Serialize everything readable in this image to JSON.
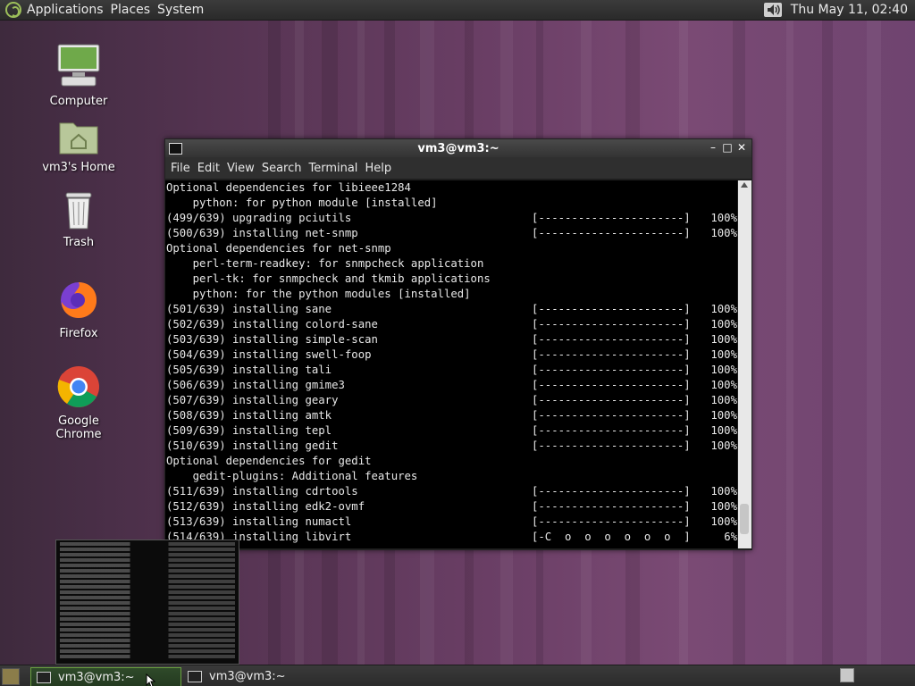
{
  "top_panel": {
    "menus": [
      "Applications",
      "Places",
      "System"
    ],
    "clock": "Thu May 11, 02:40"
  },
  "desktop_icons": [
    {
      "name": "computer",
      "label": "Computer"
    },
    {
      "name": "home",
      "label": "vm3's Home"
    },
    {
      "name": "trash",
      "label": "Trash"
    },
    {
      "name": "firefox",
      "label": "Firefox"
    },
    {
      "name": "chrome",
      "label": "Google Chrome"
    }
  ],
  "terminal": {
    "title": "vm3@vm3:~",
    "menus": [
      "File",
      "Edit",
      "View",
      "Search",
      "Terminal",
      "Help"
    ],
    "lines": [
      {
        "text": "Optional dependencies for libieee1284"
      },
      {
        "text": "    python: for python module [installed]"
      },
      {
        "text": "(499/639) upgrading pciutils",
        "bar": "[----------------------]",
        "pct": "100%"
      },
      {
        "text": "(500/639) installing net-snmp",
        "bar": "[----------------------]",
        "pct": "100%"
      },
      {
        "text": "Optional dependencies for net-snmp"
      },
      {
        "text": "    perl-term-readkey: for snmpcheck application"
      },
      {
        "text": "    perl-tk: for snmpcheck and tkmib applications"
      },
      {
        "text": "    python: for the python modules [installed]"
      },
      {
        "text": "(501/639) installing sane",
        "bar": "[----------------------]",
        "pct": "100%"
      },
      {
        "text": "(502/639) installing colord-sane",
        "bar": "[----------------------]",
        "pct": "100%"
      },
      {
        "text": "(503/639) installing simple-scan",
        "bar": "[----------------------]",
        "pct": "100%"
      },
      {
        "text": "(504/639) installing swell-foop",
        "bar": "[----------------------]",
        "pct": "100%"
      },
      {
        "text": "(505/639) installing tali",
        "bar": "[----------------------]",
        "pct": "100%"
      },
      {
        "text": "(506/639) installing gmime3",
        "bar": "[----------------------]",
        "pct": "100%"
      },
      {
        "text": "(507/639) installing geary",
        "bar": "[----------------------]",
        "pct": "100%"
      },
      {
        "text": "(508/639) installing amtk",
        "bar": "[----------------------]",
        "pct": "100%"
      },
      {
        "text": "(509/639) installing tepl",
        "bar": "[----------------------]",
        "pct": "100%"
      },
      {
        "text": "(510/639) installing gedit",
        "bar": "[----------------------]",
        "pct": "100%"
      },
      {
        "text": "Optional dependencies for gedit"
      },
      {
        "text": "    gedit-plugins: Additional features"
      },
      {
        "text": "(511/639) installing cdrtools",
        "bar": "[----------------------]",
        "pct": "100%"
      },
      {
        "text": "(512/639) installing edk2-ovmf",
        "bar": "[----------------------]",
        "pct": "100%"
      },
      {
        "text": "(513/639) installing numactl",
        "bar": "[----------------------]",
        "pct": "100%"
      },
      {
        "text": "(514/639) installing libvirt",
        "bar": "[-C  o  o  o  o  o  o  ]",
        "pct": "6%"
      }
    ]
  },
  "taskbar": {
    "tasks": [
      {
        "label": "vm3@vm3:~",
        "active": true
      },
      {
        "label": "vm3@vm3:~",
        "active": false
      }
    ]
  },
  "colors": {
    "accent": "#9cbf5a",
    "terminal_bg": "#000000",
    "desktop": "#5b3a55"
  }
}
